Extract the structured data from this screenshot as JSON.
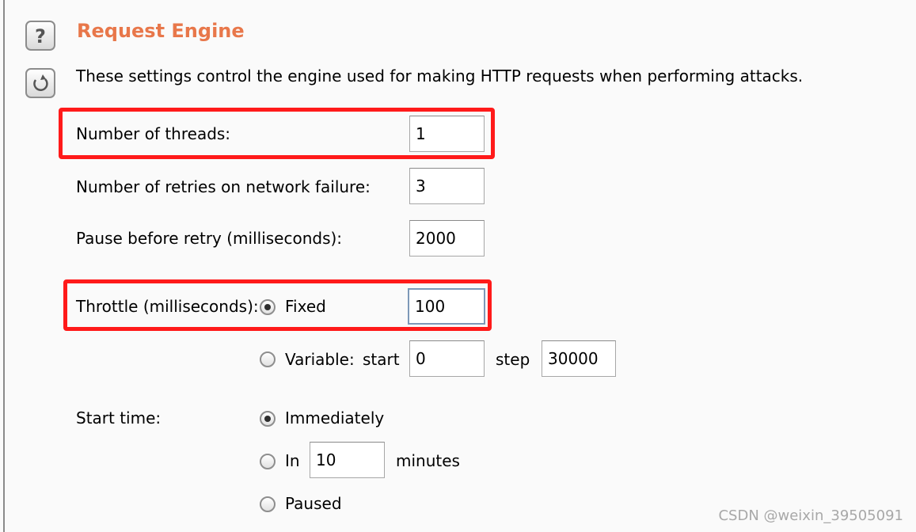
{
  "section": {
    "title": "Request Engine",
    "description": "These settings control the engine used for making HTTP requests when performing attacks."
  },
  "icons": {
    "help": "help-icon",
    "restore": "restore-defaults-icon"
  },
  "fields": {
    "threads": {
      "label": "Number of threads:",
      "value": "1"
    },
    "retries": {
      "label": "Number of retries on network failure:",
      "value": "3"
    },
    "pause": {
      "label": "Pause before retry (milliseconds):",
      "value": "2000"
    }
  },
  "throttle": {
    "label": "Throttle (milliseconds):",
    "fixed_label": "Fixed",
    "fixed_value": "100",
    "variable_label": "Variable:",
    "start_label": "start",
    "start_value": "0",
    "step_label": "step",
    "step_value": "30000",
    "selected": "fixed"
  },
  "start_time": {
    "label": "Start time:",
    "immediately_label": "Immediately",
    "in_label": "In",
    "in_value": "10",
    "minutes_label": "minutes",
    "paused_label": "Paused",
    "selected": "immediately"
  },
  "watermark": "CSDN @weixin_39505091",
  "colors": {
    "title": "#e8774a",
    "highlight": "#ff1a1a"
  }
}
